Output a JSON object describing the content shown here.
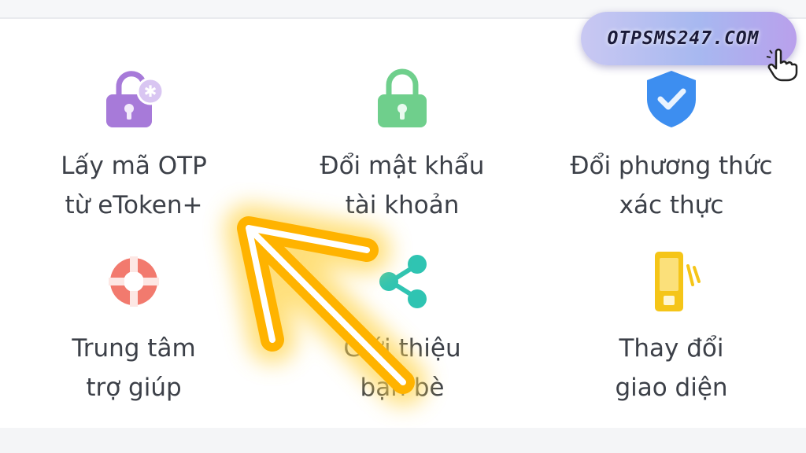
{
  "badge": {
    "text": "OTPSMS247.COM"
  },
  "tiles": [
    {
      "line1": "Lấy mã OTP",
      "line2": "từ eToken+",
      "icon": "lock-open-plus-icon",
      "color": "#a77ad9"
    },
    {
      "line1": "Đổi mật khẩu",
      "line2": "tài khoản",
      "icon": "lock-icon",
      "color": "#6fcf8c"
    },
    {
      "line1": "Đổi phương thức",
      "line2": "xác thực",
      "icon": "shield-check-icon",
      "color": "#3d8ef0"
    },
    {
      "line1": "Trung tâm",
      "line2": "trợ giúp",
      "icon": "lifebuoy-icon",
      "color": "#f27a6e"
    },
    {
      "line1": "Giới thiệu",
      "line2": "bạn bè",
      "icon": "share-icon",
      "color": "#2fc4b2"
    },
    {
      "line1": "Thay đổi",
      "line2": "giao diện",
      "icon": "phone-theme-icon",
      "color": "#f5c518"
    }
  ],
  "colors": {
    "arrow": "#ffb300",
    "arrow_glow": "#ffd54f"
  }
}
